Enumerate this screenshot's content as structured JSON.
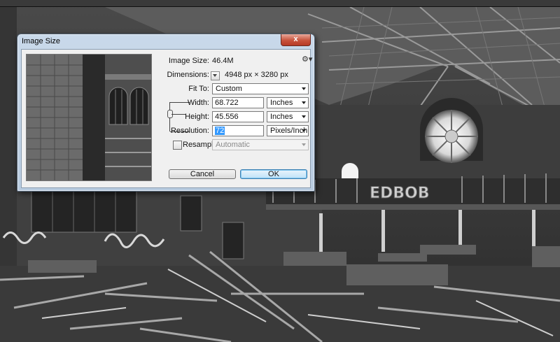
{
  "dialog": {
    "title": "Image Size",
    "close_label": "x",
    "image_size_label": "Image Size:",
    "image_size_value": "46.4M",
    "gear_icon": "gear-icon",
    "dimensions_label": "Dimensions:",
    "dimensions_value": "4948 px  ×  3280 px",
    "fit_to_label": "Fit To:",
    "fit_to_value": "Custom",
    "width_label": "Width:",
    "width_value": "68.722",
    "width_unit": "Inches",
    "height_label": "Height:",
    "height_value": "45.556",
    "height_unit": "Inches",
    "resolution_label": "Resolution:",
    "resolution_value": "72",
    "resolution_unit": "Pixels/Inch",
    "resample_label": "Resample:",
    "resample_value": "Automatic",
    "resample_checked": false,
    "cancel_label": "Cancel",
    "ok_label": "OK"
  },
  "background": {
    "sign_text": "EDBOB"
  },
  "colors": {
    "titlebar": "#c9d9ea",
    "close": "#c8523b",
    "client": "#f0f0f0",
    "selection": "#3399ff"
  }
}
